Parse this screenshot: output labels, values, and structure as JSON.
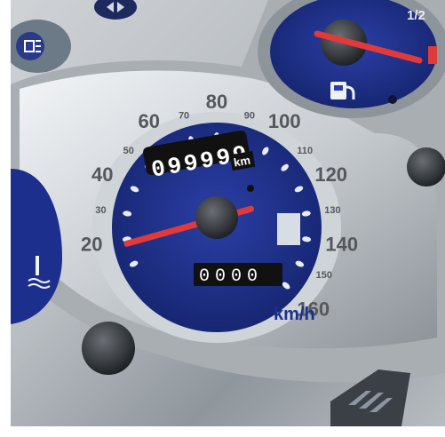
{
  "speedometer": {
    "major_labels": [
      "20",
      "40",
      "60",
      "80",
      "100",
      "120",
      "140",
      "160"
    ],
    "minor_labels": [
      "30",
      "50",
      "70",
      "90",
      "110",
      "130",
      "150"
    ],
    "unit": "km/h",
    "odometer": "099999",
    "odometer_unit": "km",
    "trip": "0000",
    "needle_speed": 15
  },
  "fuel_gauge": {
    "mark": "1/2",
    "icon": "fuel-pump-icon"
  },
  "indicators": [
    "headlight-icon",
    "turn-signal-icon",
    "coolant-temperature-icon"
  ],
  "logo": "honda-wing-logo",
  "colors": {
    "dial": "#1c2f8c",
    "needle": "#e03a3a",
    "chrome": "#c8ccd0"
  }
}
